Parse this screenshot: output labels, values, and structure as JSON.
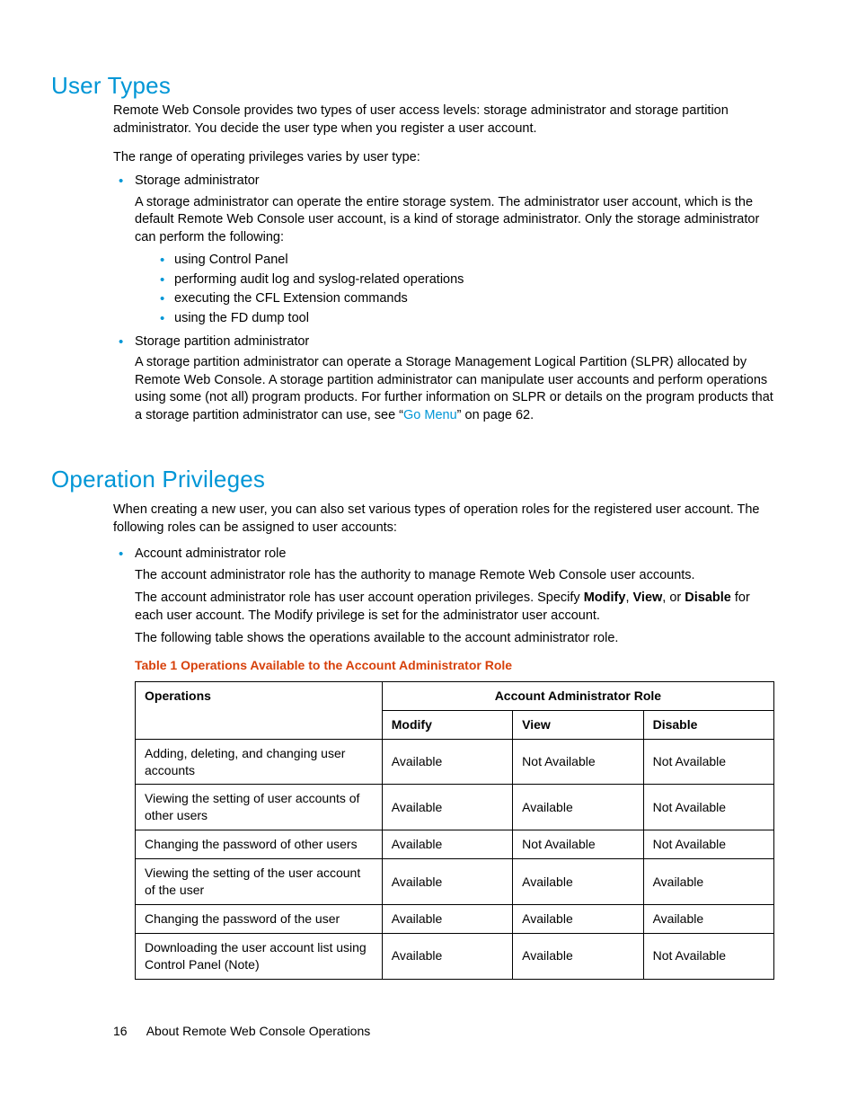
{
  "headings": {
    "user_types": "User Types",
    "operation_privileges": "Operation Privileges"
  },
  "user_types": {
    "intro1": "Remote Web Console provides two types of user access levels: storage administrator and storage partition administrator. You decide the user type when you register a user account.",
    "intro2": "The range of operating privileges varies by user type:",
    "items": [
      {
        "label": "Storage administrator",
        "desc": "A storage administrator can operate the entire storage system. The administrator user account, which is the default Remote Web Console user account, is a kind of storage administrator. Only the storage administrator can perform the following:",
        "sublist": [
          "using Control Panel",
          "performing audit log and syslog-related operations",
          "executing the CFL Extension commands",
          "using the FD dump tool"
        ]
      },
      {
        "label": "Storage partition administrator",
        "desc_pre": "A storage partition administrator can operate a Storage Management Logical Partition (SLPR) allocated by Remote Web Console. A storage partition administrator can manipulate user accounts and perform operations using some (not all) program products. For further information on SLPR or details on the program products that a storage partition administrator can use, see “",
        "link_text": "Go Menu",
        "desc_post": "” on page 62."
      }
    ]
  },
  "op_privs": {
    "intro": "When creating a new user, you can also set various types of operation roles for the registered user account. The following roles can be assigned to user accounts:",
    "role_label": "Account administrator role",
    "p1": "The account administrator role has the authority to manage Remote Web Console user accounts.",
    "p2_pre": "The account administrator role has user account operation privileges. Specify ",
    "p2_b1": "Modify",
    "p2_mid1": ", ",
    "p2_b2": "View",
    "p2_mid2": ", or ",
    "p2_b3": "Disable",
    "p2_post": " for each user account. The Modify privilege is set for the administrator user account.",
    "p3": "The following table shows the operations available to the account administrator role.",
    "table_caption": "Table 1 Operations Available to the Account Administrator Role",
    "table": {
      "head_ops": "Operations",
      "head_group": "Account Administrator Role",
      "head_cols": [
        "Modify",
        "View",
        "Disable"
      ],
      "rows": [
        {
          "op": "Adding, deleting, and changing user accounts",
          "vals": [
            "Available",
            "Not Available",
            "Not Available"
          ]
        },
        {
          "op": "Viewing the setting of user accounts of other users",
          "vals": [
            "Available",
            "Available",
            "Not Available"
          ]
        },
        {
          "op": "Changing the password of other users",
          "vals": [
            "Available",
            "Not Available",
            "Not Available"
          ]
        },
        {
          "op": "Viewing the setting of the user account of the user",
          "vals": [
            "Available",
            "Available",
            "Available"
          ]
        },
        {
          "op": "Changing the password of the user",
          "vals": [
            "Available",
            "Available",
            "Available"
          ]
        },
        {
          "op": "Downloading the user account list using Control Panel (Note)",
          "vals": [
            "Available",
            "Available",
            "Not Available"
          ]
        }
      ]
    }
  },
  "footer": {
    "page_number": "16",
    "title": "About Remote Web Console Operations"
  }
}
